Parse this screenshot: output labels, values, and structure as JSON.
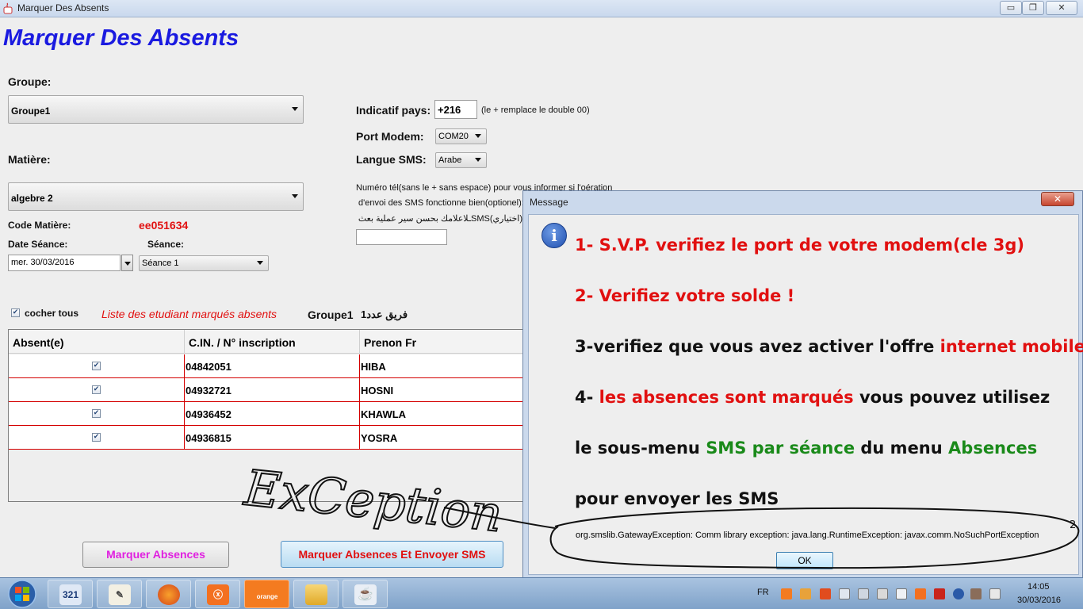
{
  "window": {
    "title": "Marquer Des Absents",
    "buttons": {
      "minimize": "▭",
      "maximize": "❐",
      "close": "✕"
    }
  },
  "form": {
    "main_title": "Marquer Des Absents",
    "groupe_label": "Groupe:",
    "groupe_value": "Groupe1",
    "matiere_label": "Matière:",
    "matiere_value": "algebre 2",
    "code_matiere_label": "Code Matière:",
    "code_matiere_value": "ee051634",
    "date_seance_label": "Date Séance:",
    "date_value": "mer. 30/03/2016",
    "seance_label": "Séance:",
    "seance_value": "Séance 1",
    "indicatif_label": "Indicatif pays:",
    "indicatif_value": "+216",
    "indicatif_hint": "(le + remplace le double 00)",
    "port_modem_label": "Port Modem:",
    "port_modem_value": "COM20",
    "langue_sms_label": "Langue SMS:",
    "langue_sms_value": "Arabe",
    "phone_info_line1": "Numéro tél(sans le + sans espace) pour vous informer si l'oération",
    "phone_info_line2": "d'envoi des SMS fonctionne bien(optionel):",
    "phone_info_line3": "(اختياري)SMS‏‏‏ـلاعلامك بحسن سير عملية بعث ال",
    "phone_value": ""
  },
  "list_bar": {
    "cocher_tous_label": "cocher tous",
    "cocher_tous_checked": true,
    "liste_label": "Liste des etudiant marqués absents",
    "groupe_name": "Groupe1",
    "groupe_count_label": "فريق عدد1"
  },
  "table": {
    "columns": [
      "Absent(e)",
      "C.IN. / N° inscription",
      "Prenon Fr"
    ],
    "rows": [
      {
        "absent": true,
        "cin": "04842051",
        "prenom": "HIBA"
      },
      {
        "absent": true,
        "cin": "04932721",
        "prenom": "HOSNI"
      },
      {
        "absent": true,
        "cin": "04936452",
        "prenom": "KHAWLA"
      },
      {
        "absent": true,
        "cin": "04936815",
        "prenom": "YOSRA"
      }
    ]
  },
  "actions": {
    "marquer_label": "Marquer Absences",
    "marquer_sms_label": "Marquer Absences Et Envoyer SMS"
  },
  "dialog": {
    "title": "Message",
    "close": "✕",
    "info_icon": "i",
    "line1": "1- S.V.P. verifiez le port de votre modem(cle 3g)",
    "line2": "2- Verifiez votre solde !",
    "line3_a": "3-verifiez que vous avez activer l'offre ",
    "line3_b": "internet mobile",
    "line4_a": "4- ",
    "line4_b": "les absences sont marqués",
    "line4_c": " vous pouvez utilisez",
    "line5_a": "le sous-menu ",
    "line5_b": "SMS par séance",
    "line5_c": " du menu ",
    "line5_d": "Absences",
    "line6": "pour envoyer les SMS",
    "exception": "org.smslib.GatewayException: Comm library exception: java.lang.RuntimeException: javax.comm.NoSuchPortException",
    "ok_label": "OK"
  },
  "annotation": {
    "handwritten": "ExCeption",
    "mark": "2"
  },
  "taskbar": {
    "items": [
      "321",
      "notes",
      "firefox",
      "xampp",
      "orange",
      "explorer",
      "java"
    ],
    "orange_label": "orange",
    "xampp_label": "ⓧ",
    "java_label": "☕",
    "language": "FR",
    "time": "14:05",
    "date": "30/03/2016"
  },
  "colors": {
    "title_blue": "#1a1ae0",
    "warning_red": "#e11010",
    "ok_green": "#1a8a1a",
    "magenta_button_text": "#e020e0",
    "table_line_red": "#d40000"
  }
}
